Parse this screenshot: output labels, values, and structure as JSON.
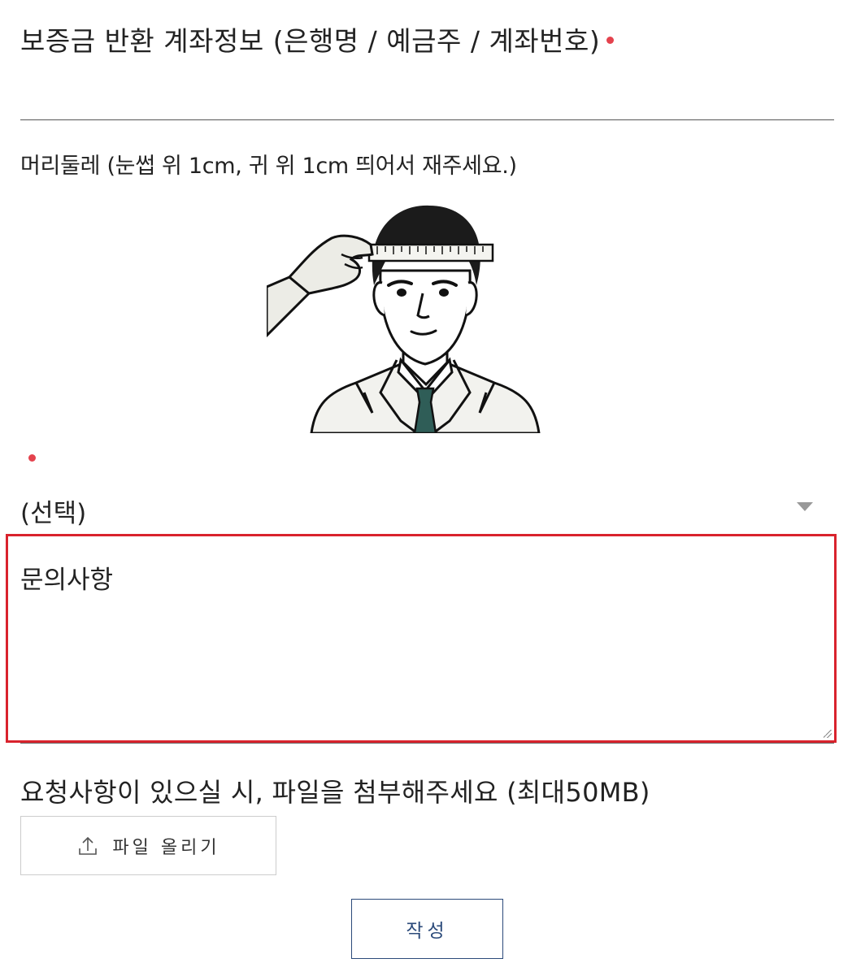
{
  "bank_account": {
    "label": "보증금 반환 계좌정보 (은행명 / 예금주 / 계좌번호)",
    "value": ""
  },
  "head_circumference": {
    "label": "머리둘레 (눈썹 위 1cm, 귀 위 1cm 띄어서 재주세요.)",
    "select_value": "(선택)"
  },
  "inquiry": {
    "placeholder": "문의사항"
  },
  "file_upload": {
    "label": "요청사항이 있으실 시, 파일을 첨부해주세요 (최대50MB)",
    "button_label": "파일 올리기"
  },
  "submit": {
    "label": "작성"
  },
  "colors": {
    "required_dot": "#e4424d",
    "highlight_border": "#d9232d",
    "submit_accent": "#2b4a7a",
    "tie": "#2f5d57"
  },
  "icons": {
    "upload": "upload-icon",
    "dropdown": "chevron-down-icon"
  }
}
